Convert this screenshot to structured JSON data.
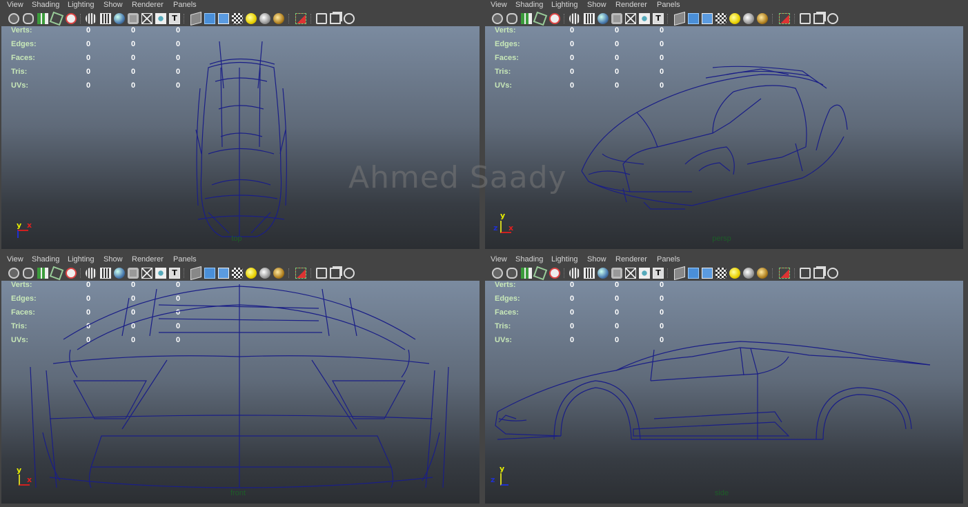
{
  "menus": [
    "View",
    "Shading",
    "Lighting",
    "Show",
    "Renderer",
    "Panels"
  ],
  "toolbar_icons": [
    "select-camera-icon",
    "camera-attributes-icon",
    "bookmarks-icon",
    "image-plane-icon",
    "track-icon",
    "grid-icon",
    "film-gate-icon",
    "smooth-shade-icon",
    "flat-shade-icon",
    "wireframe-icon",
    "isolate-icon",
    "textured-icon",
    "wireframe-on-shaded-icon",
    "xray-icon",
    "default-lighting-icon",
    "all-lights-icon",
    "shadows-icon",
    "isolate-select-icon",
    "xray-joints-icon",
    "xray-active-icon",
    "hud-icon"
  ],
  "hud": {
    "labels": [
      "Verts:",
      "Edges:",
      "Faces:",
      "Tris:",
      "UVs:"
    ],
    "values": [
      "0",
      "0",
      "0"
    ]
  },
  "panels": {
    "top": {
      "name": "top"
    },
    "persp": {
      "name": "persp"
    },
    "front": {
      "name": "front"
    },
    "side": {
      "name": "side"
    }
  },
  "axes": {
    "x": "x",
    "y": "y",
    "z": "z"
  },
  "watermark": "Ahmed Saady",
  "colors": {
    "wire": "#1a1e86",
    "panel_bg": "#444444",
    "hud_label": "#c8e8b8",
    "viewport_name": "#1d5c28"
  }
}
